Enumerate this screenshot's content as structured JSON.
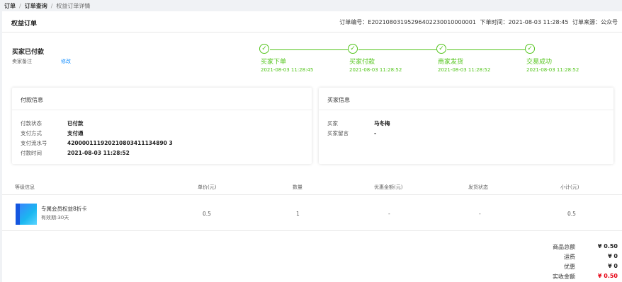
{
  "breadcrumb": {
    "items": [
      "订单",
      "订单查询",
      "权益订单详情"
    ],
    "separator": "/"
  },
  "order": {
    "title": "权益订单",
    "order_no_label": "订单编号：",
    "order_no": "E20210803195296402230010000001",
    "order_time_label": "下单时间：",
    "order_time": "2021-08-03 11:28:45",
    "source_label": "订单来源：",
    "source": "公众号"
  },
  "status": {
    "title": "买家已付款",
    "remark_label": "卖家备注",
    "remark_link": "修改"
  },
  "steps": [
    {
      "label": "买家下单",
      "time": "2021-08-03 11:28:45",
      "icon": "check-icon"
    },
    {
      "label": "买家付款",
      "time": "2021-08-03 11:28:52",
      "icon": "check-icon"
    },
    {
      "label": "商家发货",
      "time": "2021-08-03 11:28:52",
      "icon": "check-icon"
    },
    {
      "label": "交易成功",
      "time": "2021-08-03 11:28:52",
      "icon": "check-icon"
    }
  ],
  "payment": {
    "title": "付款信息",
    "rows": [
      {
        "key": "付款状态",
        "value": "已付款"
      },
      {
        "key": "支付方式",
        "value": "支付通"
      },
      {
        "key": "支付流水号",
        "value": "420000111920210803411134890 3"
      },
      {
        "key": "付款时间",
        "value": "2021-08-03 11:28:52"
      }
    ]
  },
  "buyer": {
    "title": "买家信息",
    "rows": [
      {
        "key": "买家",
        "value": "马冬梅"
      },
      {
        "key": "买家留言",
        "value": "-"
      }
    ]
  },
  "table": {
    "headers": {
      "item": "等级信息",
      "price": "单价(元)",
      "qty": "数量",
      "discount": "优惠金额(元)",
      "shipping": "发货状态",
      "subtotal": "小计(元)"
    },
    "row": {
      "name": "专属会员权益8折卡",
      "valid": "有效期:30天",
      "price": "0.5",
      "qty": "1",
      "discount": "-",
      "shipping": "-",
      "subtotal": "0.5"
    }
  },
  "summary": [
    {
      "label": "商品总额",
      "value": "¥ 0.50"
    },
    {
      "label": "运费",
      "value": "¥ 0"
    },
    {
      "label": "优惠",
      "value": "¥ 0"
    },
    {
      "label": "实收金额",
      "value": "¥ 0.50"
    }
  ],
  "colors": {
    "success": "#52c41a",
    "link": "#1890ff",
    "price_red": "#e60012"
  }
}
